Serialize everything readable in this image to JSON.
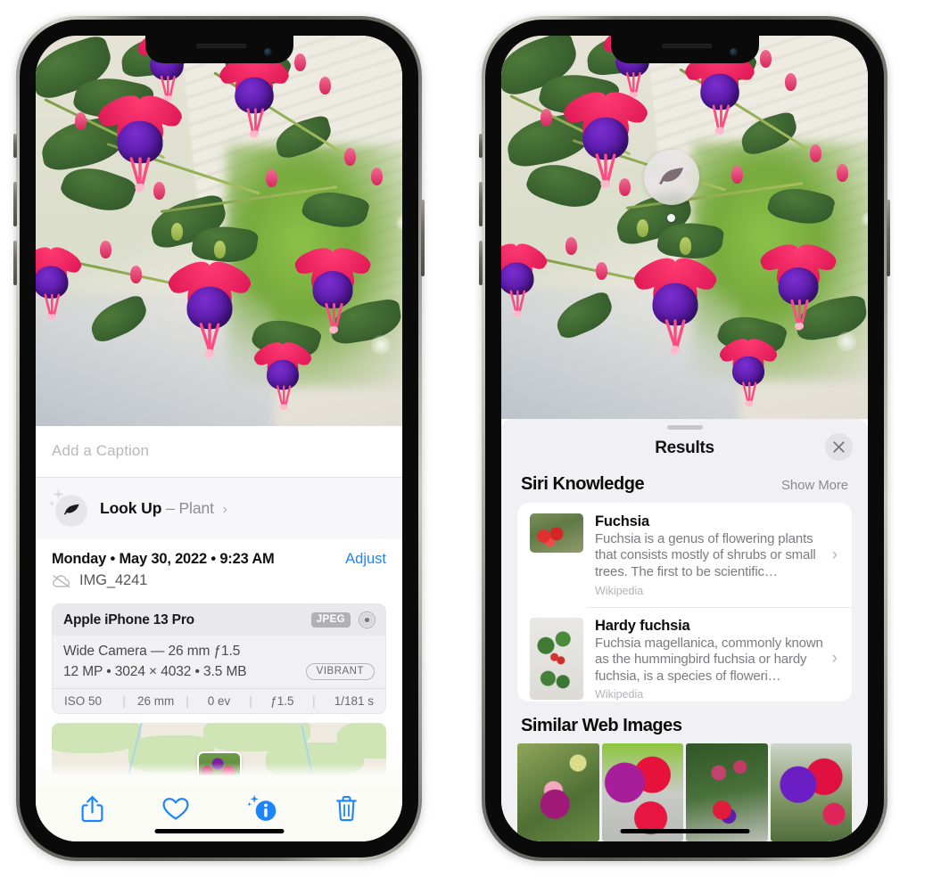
{
  "page": {
    "background": "#ffffff",
    "accent_blue": "#1c84fc"
  },
  "left_phone": {
    "name": "iPhone showing Photos app info sheet",
    "photo": {
      "alt": "Close-up of pink and purple fuchsia flowers hanging from a plant"
    },
    "caption_field": {
      "placeholder": "Add a Caption",
      "value": ""
    },
    "lookup_row": {
      "icon": "leaf-icon",
      "label": "Look Up",
      "separator": "–",
      "subject": "Plant",
      "chevron": "›"
    },
    "meta": {
      "date_line": "Monday • May 30, 2022 • 9:23 AM",
      "adjust_label": "Adjust",
      "cloud_icon": "cloud-slash-icon",
      "filename": "IMG_4241"
    },
    "camera_card": {
      "device": "Apple iPhone 13 Pro",
      "format_badge": "JPEG",
      "aperture_icon": "aperture-icon",
      "lens_line": "Wide Camera — 26 mm ƒ1.5",
      "spec_line": "12 MP • 3024 × 4032 • 3.5 MB",
      "style_badge": "VIBRANT",
      "exif": [
        "ISO 50",
        "26 mm",
        "0 ev",
        "ƒ1.5",
        "1/181 s"
      ]
    },
    "map": {
      "alt": "Map thumbnail with photo location pin"
    },
    "toolbar": {
      "items": [
        {
          "icon": "share-icon",
          "label": "Share"
        },
        {
          "icon": "heart-icon",
          "label": "Favorite"
        },
        {
          "icon": "info-sparkle-icon",
          "label": "Info"
        },
        {
          "icon": "trash-icon",
          "label": "Delete"
        }
      ]
    }
  },
  "right_phone": {
    "name": "iPhone showing Visual Look Up Results sheet",
    "photo": {
      "alt": "Close-up of pink and purple fuchsia flowers hanging from a plant"
    },
    "leaf_badge": {
      "icon": "leaf-icon",
      "label": "Plant detected"
    },
    "sheet": {
      "grabber": true,
      "title": "Results",
      "close_icon": "close-icon"
    },
    "siri_knowledge": {
      "title": "Siri Knowledge",
      "show_more": "Show More",
      "items": [
        {
          "title": "Fuchsia",
          "description": "Fuchsia is a genus of flowering plants that consists mostly of shrubs or small trees. The first to be scientific…",
          "source": "Wikipedia",
          "thumb": "fuchsia-wild-thumb",
          "chevron": "›"
        },
        {
          "title": "Hardy fuchsia",
          "description": "Fuchsia magellanica, commonly known as the hummingbird fuchsia or hardy fuchsia, is a species of floweri…",
          "source": "Wikipedia",
          "thumb": "hardy-fuchsia-thumb",
          "chevron": "›"
        }
      ]
    },
    "similar_web_images": {
      "title": "Similar Web Images",
      "items": [
        {
          "alt": "Pink and magenta fuchsia flower with green leaves"
        },
        {
          "alt": "Red and purple fuchsia blossoms close up"
        },
        {
          "alt": "Fuchsia shrub with many red buds"
        },
        {
          "alt": "Purple and red double fuchsia flowers"
        }
      ]
    }
  }
}
